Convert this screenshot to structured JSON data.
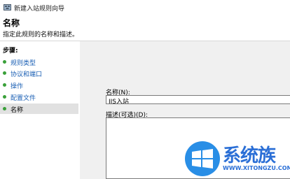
{
  "window": {
    "title": "新建入站规则向导",
    "icon": "firewall-wizard-icon"
  },
  "page": {
    "heading": "名称",
    "subtitle": "指定此规则的名称和描述。"
  },
  "steps": {
    "header": "步骤:",
    "items": [
      {
        "label": "规则类型",
        "current": false
      },
      {
        "label": "协议和端口",
        "current": false
      },
      {
        "label": "操作",
        "current": false
      },
      {
        "label": "配置文件",
        "current": false
      },
      {
        "label": "名称",
        "current": true
      }
    ],
    "dot_color": "#3aa03a",
    "link_color": "#1a5fb4"
  },
  "form": {
    "name_label": "名称(N):",
    "name_value": "IIS入站",
    "description_label": "描述(可选)(D):",
    "description_value": ""
  },
  "watermark": {
    "logo_text": "系统族",
    "url": "WWW.XITONGZU.COM",
    "icon": "windows-logo-icon",
    "color": "#2b6fd6"
  }
}
